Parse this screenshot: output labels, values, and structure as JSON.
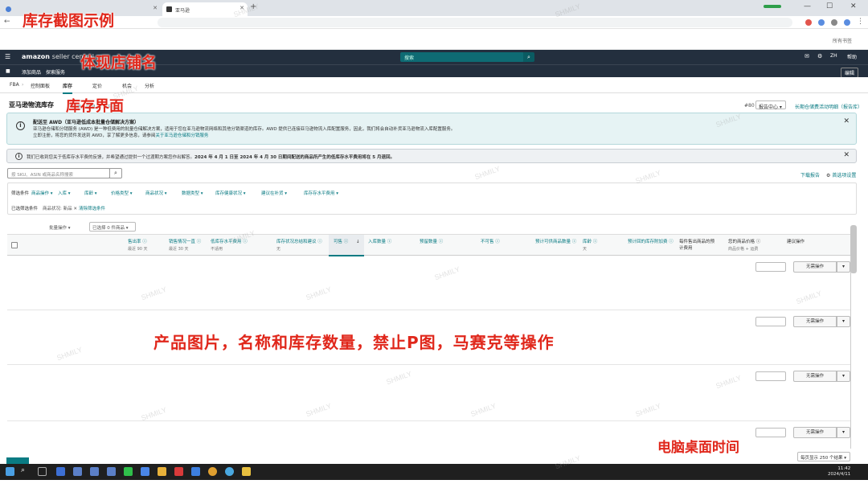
{
  "browser": {
    "tabs": [
      {
        "label": ""
      },
      {
        "label": ""
      },
      {
        "label": "亚马逊"
      }
    ],
    "new_tab": "+",
    "window_controls": [
      "—",
      "☐",
      "✕"
    ],
    "bookmark": "所有书签"
  },
  "header": {
    "logo": "amazon",
    "logo_sub": "seller central",
    "search_placeholder": "搜索",
    "language": "ZH",
    "help": "帮助",
    "sub_items": [
      "添加商品",
      "探索服务"
    ],
    "edit": "编辑",
    "nav": [
      "FBA",
      "控制面板",
      "库存",
      "定价",
      "机会",
      "分析"
    ]
  },
  "page": {
    "title": "亚马逊物流库存",
    "title_link": "了解更多信息  |  \"亚马逊\"",
    "region_label": "#80",
    "region_select": "报告中心",
    "top_link": "长期仓储费活动明细（报告库）",
    "banner1": {
      "title": "配送至 AWD（亚马逊低成本批量仓储解决方案）",
      "line1": "亚马逊仓储和分销服务 (AWD) 是一种低费用的批量仓储解决方案，适用于您在亚马逊物流网络和其他分销渠道的库存。AWD 提供已连接亚马逊物流入库配置服务，因此，我们将会自动补货亚马逊物流入库配置服务。",
      "line2_prefix": "立即注册，将您的货件发送到 AWD，享了解更多信息，请参阅",
      "line2_link": "关于亚马逊仓储和分销服务",
      "close": "✕"
    },
    "banner2": {
      "text_prefix": "我们已收到您关于低库存水平费的反馈，并希望通过提供一个过渡期方案您作出解答。",
      "text_bold": "2024 年 4 月 1 日至 2024 年 4 月 30 日期间配送的商品所产生的低库存水平费用将在 5 月退回。",
      "close": "✕"
    },
    "search_placeholder": "按 SKU、ASIN 或商品名称搜索",
    "right_links": [
      "下载报告",
      "首选项设置"
    ],
    "filters_label": "筛选条件",
    "filters": [
      "商品操作 ▾",
      "入库 ▾",
      "库龄 ▾",
      "价格类型 ▾",
      "商品状况 ▾",
      "数据类型 ▾",
      "库存健康状况 ▾",
      "建议在补货 ▾",
      "库存存水平费用 ▾"
    ],
    "applied_label": "已选筛选条件",
    "applied_values": "商品状况: 新品 ✕",
    "applied_clear": "清除筛选条件",
    "bulk_label": "批量操作",
    "bulk_select": "已选择 0 件商品",
    "columns": [
      {
        "label": "售出率",
        "sub": "最近 90 天"
      },
      {
        "label": "销售情况一直",
        "sub": "最近 30 天"
      },
      {
        "label": "低库存水平费用",
        "sub": "不适用"
      },
      {
        "label": "库存状况总结和建议",
        "sub": "无"
      },
      {
        "label": "可售",
        "sub": ""
      },
      {
        "label": "入库数量",
        "sub": ""
      },
      {
        "label": "预留数量",
        "sub": ""
      },
      {
        "label": "不可售",
        "sub": ""
      },
      {
        "label": "预计可供商品数量",
        "sub": ""
      },
      {
        "label": "库龄",
        "sub": "天"
      },
      {
        "label": "预计回的库存附加费",
        "sub": ""
      },
      {
        "label": "每件售出商品的预计费用",
        "sub": ""
      },
      {
        "label": "您的商品价格",
        "sub": "商品价格 + 运费"
      },
      {
        "label": "建议操作",
        "sub": ""
      }
    ],
    "row_action": "无需操作",
    "row_dropdown": "▾",
    "pager": "每页显示 250 个结果"
  },
  "taskbar": {
    "time": "11:42",
    "date": "2024/4/11"
  },
  "annotations": {
    "a1": "库存截图示例",
    "a2": "体现店铺名",
    "a3": "库存界面",
    "a4": "产品图片，名称和库存数量，禁止P图，马赛克等操作",
    "a5": "电脑桌面时间"
  },
  "watermark": "SHMILY",
  "colors": {
    "annotation": "#e0271b",
    "amazon_header": "#232f3e",
    "teal": "#0a7b83"
  }
}
